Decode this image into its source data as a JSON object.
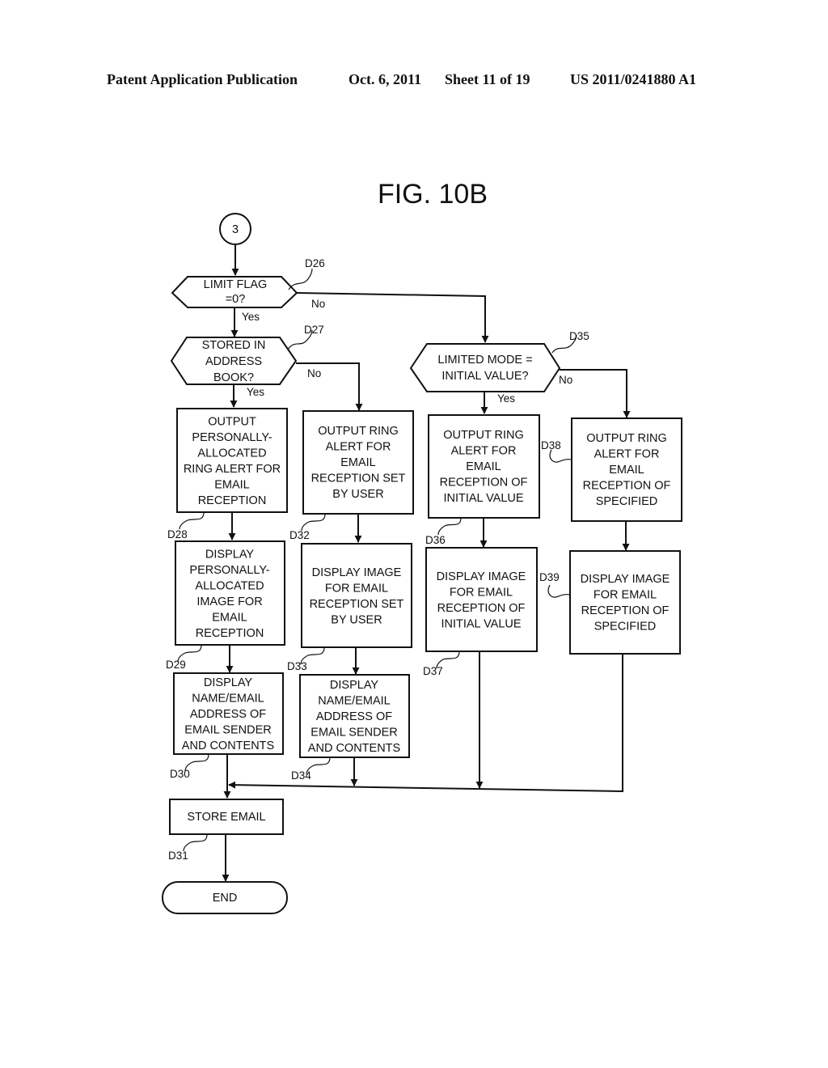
{
  "header": {
    "publication": "Patent Application Publication",
    "date": "Oct. 6, 2011",
    "sheet": "Sheet 11 of 19",
    "number": "US 2011/0241880 A1"
  },
  "figure": {
    "title": "FIG. 10B",
    "connector": "3",
    "nodes": {
      "d26": {
        "ref": "D26",
        "type": "decision",
        "lines": [
          "LIMIT FLAG",
          "=0?"
        ]
      },
      "d27": {
        "ref": "D27",
        "type": "decision",
        "lines": [
          "STORED IN",
          "ADDRESS",
          "BOOK?"
        ]
      },
      "d35": {
        "ref": "D35",
        "type": "decision",
        "lines": [
          "LIMITED MODE =",
          "INITIAL VALUE?"
        ]
      },
      "d28": {
        "ref": "D28",
        "type": "process",
        "lines": [
          "OUTPUT",
          "PERSONALLY-",
          "ALLOCATED",
          "RING ALERT FOR",
          "EMAIL",
          "RECEPTION"
        ]
      },
      "d32": {
        "ref": "D32",
        "type": "process",
        "lines": [
          "OUTPUT RING",
          "ALERT FOR",
          "EMAIL",
          "RECEPTION SET",
          "BY USER"
        ]
      },
      "d36": {
        "ref": "D36",
        "type": "process",
        "lines": [
          "OUTPUT RING",
          "ALERT FOR",
          "EMAIL",
          "RECEPTION OF",
          "INITIAL VALUE"
        ]
      },
      "d38": {
        "ref": "D38",
        "type": "process",
        "lines": [
          "OUTPUT RING",
          "ALERT FOR",
          "EMAIL",
          "RECEPTION OF",
          "SPECIFIED"
        ]
      },
      "d29": {
        "ref": "D29",
        "type": "process",
        "lines": [
          "DISPLAY",
          "PERSONALLY-",
          "ALLOCATED",
          "IMAGE FOR",
          "EMAIL",
          "RECEPTION"
        ]
      },
      "d33": {
        "ref": "D33",
        "type": "process",
        "lines": [
          "DISPLAY IMAGE",
          "FOR EMAIL",
          "RECEPTION SET",
          "BY USER"
        ]
      },
      "d37": {
        "ref": "D37",
        "type": "process",
        "lines": [
          "DISPLAY IMAGE",
          "FOR EMAIL",
          "RECEPTION OF",
          "INITIAL VALUE"
        ]
      },
      "d39": {
        "ref": "D39",
        "type": "process",
        "lines": [
          "DISPLAY IMAGE",
          "FOR EMAIL",
          "RECEPTION OF",
          "SPECIFIED"
        ]
      },
      "d30": {
        "ref": "D30",
        "type": "process",
        "lines": [
          "DISPLAY",
          "NAME/EMAIL",
          "ADDRESS  OF",
          "EMAIL SENDER",
          "AND CONTENTS"
        ]
      },
      "d34": {
        "ref": "D34",
        "type": "process",
        "lines": [
          "DISPLAY",
          "NAME/EMAIL",
          "ADDRESS OF",
          "EMAIL SENDER",
          "AND CONTENTS"
        ]
      },
      "d31": {
        "ref": "D31",
        "type": "process",
        "lines": [
          "STORE EMAIL"
        ]
      },
      "end": {
        "type": "terminal",
        "lines": [
          "END"
        ]
      }
    },
    "branch_labels": {
      "d26_yes": "Yes",
      "d26_no": "No",
      "d27_yes": "Yes",
      "d27_no": "No",
      "d35_yes": "Yes",
      "d35_no": "No"
    },
    "edges": [
      {
        "from": "connector",
        "to": "d26"
      },
      {
        "from": "d26",
        "to": "d27",
        "label": "Yes"
      },
      {
        "from": "d26",
        "to": "d35",
        "label": "No"
      },
      {
        "from": "d27",
        "to": "d28",
        "label": "Yes"
      },
      {
        "from": "d27",
        "to": "d32",
        "label": "No"
      },
      {
        "from": "d35",
        "to": "d36",
        "label": "Yes"
      },
      {
        "from": "d35",
        "to": "d38",
        "label": "No"
      },
      {
        "from": "d28",
        "to": "d29"
      },
      {
        "from": "d29",
        "to": "d30"
      },
      {
        "from": "d32",
        "to": "d33"
      },
      {
        "from": "d33",
        "to": "d34"
      },
      {
        "from": "d36",
        "to": "d37"
      },
      {
        "from": "d38",
        "to": "d39"
      },
      {
        "from": "d30",
        "to": "d31"
      },
      {
        "from": "d34",
        "to": "d31"
      },
      {
        "from": "d37",
        "to": "d31"
      },
      {
        "from": "d39",
        "to": "d31"
      },
      {
        "from": "d31",
        "to": "end"
      }
    ]
  }
}
